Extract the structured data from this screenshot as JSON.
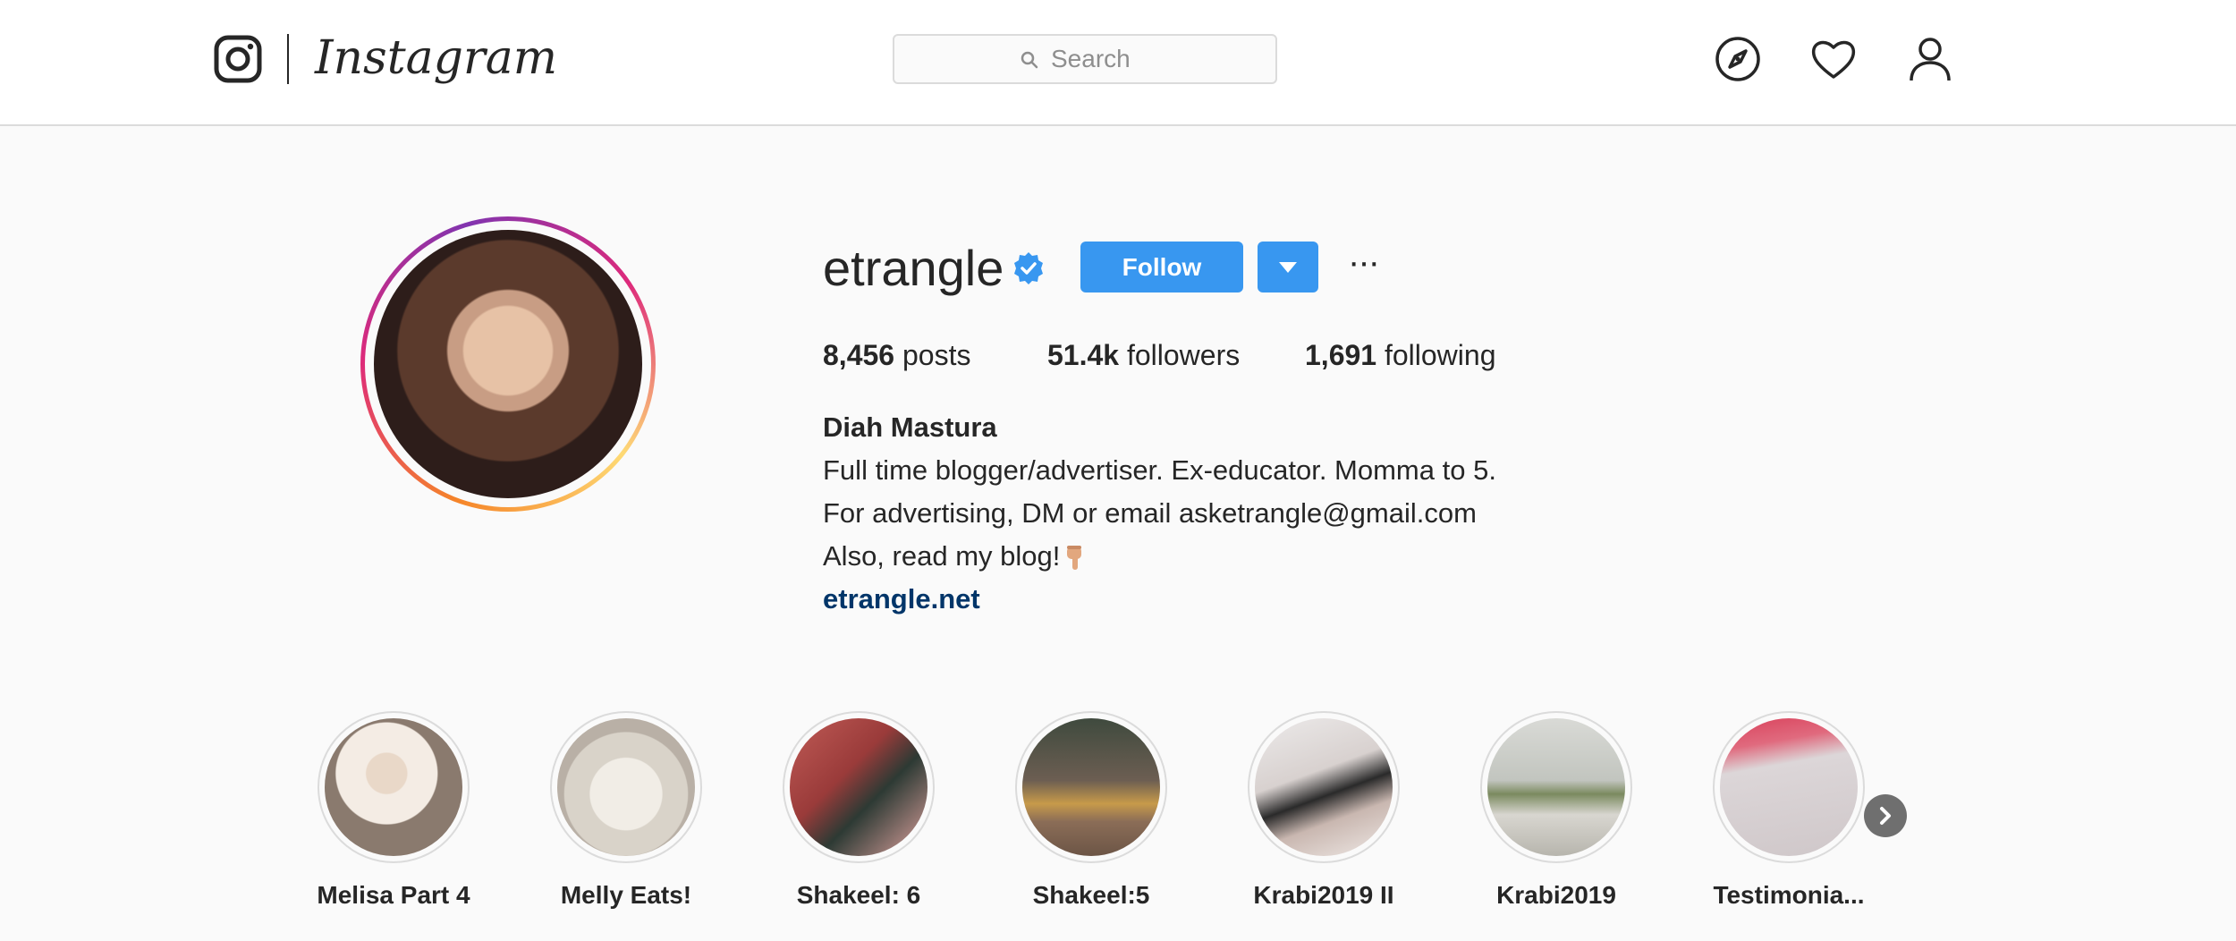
{
  "header": {
    "wordmark": "Instagram",
    "search_placeholder": "Search",
    "icons": [
      "instagram-glyph-icon",
      "explore-compass-icon",
      "activity-heart-icon",
      "profile-person-icon"
    ]
  },
  "profile": {
    "username": "etrangle",
    "verified": true,
    "follow_label": "Follow",
    "stats": {
      "posts_count": "8,456",
      "posts_label": " posts",
      "followers_count": "51.4k",
      "followers_label": " followers",
      "following_count": "1,691",
      "following_label": " following"
    },
    "full_name": "Diah Mastura",
    "bio": [
      "Full time blogger/advertiser. Ex-educator. Momma to 5.",
      "For advertising, DM or email asketrangle@gmail.com",
      "Also, read my blog!"
    ],
    "website": "etrangle.net"
  },
  "highlights": [
    {
      "label": "Melisa Part 4"
    },
    {
      "label": "Melly Eats!"
    },
    {
      "label": "Shakeel: 6"
    },
    {
      "label": "Shakeel:5"
    },
    {
      "label": "Krabi2019 II"
    },
    {
      "label": "Krabi2019"
    },
    {
      "label": "Testimonia..."
    }
  ],
  "colors": {
    "primary_blue": "#3897f0",
    "link_blue": "#003569",
    "text": "#262626",
    "muted": "#8e8e8e",
    "border": "#dbdbdb",
    "background": "#fafafa"
  }
}
